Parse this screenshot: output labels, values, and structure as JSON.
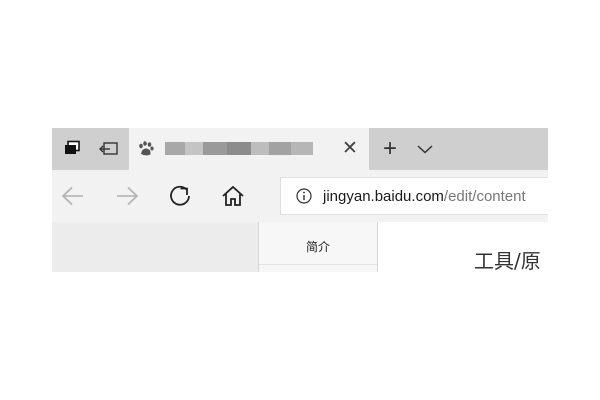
{
  "browser": {
    "tab": {
      "title": "",
      "title_obscured": true,
      "favicon": "baidu-paw-icon"
    },
    "tab_strip_icons": [
      "tabs-aside-icon",
      "restore-tabs-icon"
    ],
    "address_bar": {
      "host": "jingyan.baidu.com",
      "path": "/edit/content"
    },
    "nav_icons": [
      "back-arrow-icon",
      "forward-arrow-icon",
      "refresh-icon",
      "home-icon",
      "info-icon"
    ]
  },
  "page": {
    "toc": {
      "items": [
        "简介"
      ]
    },
    "heading": "工具/原"
  },
  "colors": {
    "tab_strip": "#cfcfcf",
    "active_tab": "#f2f2f2",
    "url_host": "#1a1a1a",
    "url_path": "#777777"
  }
}
